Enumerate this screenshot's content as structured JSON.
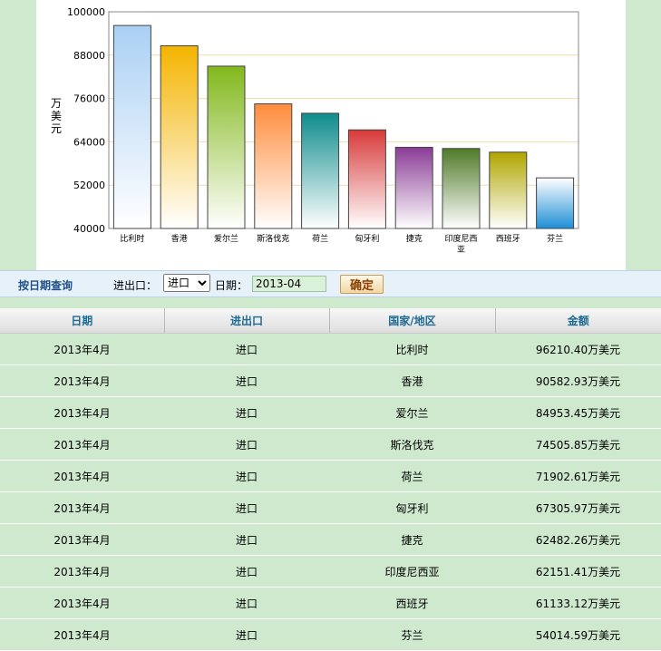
{
  "chart_data": {
    "type": "bar",
    "ylabel": "万美元",
    "ylim": [
      40000,
      100000
    ],
    "yticks": [
      "100000",
      "88000",
      "76000",
      "64000",
      "52000",
      "40000"
    ],
    "categories": [
      "比利时",
      "香港",
      "爱尔兰",
      "斯洛伐克",
      "荷兰",
      "匈牙利",
      "捷克",
      "印度尼西亚",
      "西班牙",
      "芬兰"
    ],
    "values": [
      96210.4,
      90582.93,
      84953.45,
      74505.85,
      71902.61,
      67305.97,
      62482.26,
      62151.41,
      61133.12,
      54014.59
    ],
    "colors": [
      [
        "#aad0f4",
        "#ffffff"
      ],
      [
        "#f4b400",
        "#ffffff"
      ],
      [
        "#82b81c",
        "#ffffff"
      ],
      [
        "#ff8c3c",
        "#ffffff"
      ],
      [
        "#0f8c8c",
        "#ffffff"
      ],
      [
        "#d83a3a",
        "#ffffff"
      ],
      [
        "#8a3c96",
        "#ffffff"
      ],
      [
        "#4e7a28",
        "#ffffff"
      ],
      [
        "#b0a600",
        "#ffffff"
      ],
      [
        "#ffffff",
        "#1e8ed6"
      ]
    ]
  },
  "query": {
    "title": "按日期查询",
    "io_label": "进出口：",
    "io_selected": "进口",
    "date_label": "日期：",
    "date_value": "2013-04",
    "submit_label": "确定"
  },
  "table": {
    "headers": [
      "日期",
      "进出口",
      "国家/地区",
      "金额"
    ],
    "rows": [
      [
        "2013年4月",
        "进口",
        "比利时",
        "96210.40万美元"
      ],
      [
        "2013年4月",
        "进口",
        "香港",
        "90582.93万美元"
      ],
      [
        "2013年4月",
        "进口",
        "爱尔兰",
        "84953.45万美元"
      ],
      [
        "2013年4月",
        "进口",
        "斯洛伐克",
        "74505.85万美元"
      ],
      [
        "2013年4月",
        "进口",
        "荷兰",
        "71902.61万美元"
      ],
      [
        "2013年4月",
        "进口",
        "匈牙利",
        "67305.97万美元"
      ],
      [
        "2013年4月",
        "进口",
        "捷克",
        "62482.26万美元"
      ],
      [
        "2013年4月",
        "进口",
        "印度尼西亚",
        "62151.41万美元"
      ],
      [
        "2013年4月",
        "进口",
        "西班牙",
        "61133.12万美元"
      ],
      [
        "2013年4月",
        "进口",
        "芬兰",
        "54014.59万美元"
      ]
    ]
  }
}
